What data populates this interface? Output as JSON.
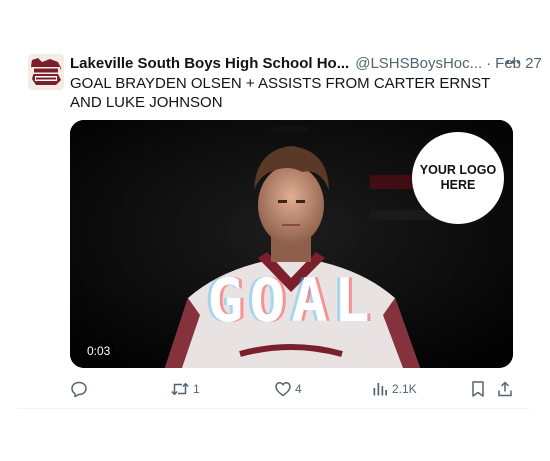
{
  "tweet": {
    "author_name": "Lakeville South Boys High School Ho...",
    "handle": "@LSHSBoysHoc...",
    "separator": "·",
    "date": "Feb 27",
    "text": "GOAL BRAYDEN OLSEN + ASSISTS FROM CARTER ERNST AND LUKE JOHNSON",
    "avatar_icon": "team-logo-icon",
    "menu_icon": "more-icon"
  },
  "media": {
    "logo_line1": "YOUR LOGO",
    "logo_line2": "HERE",
    "overlay_text": "GOAL",
    "timestamp": "0:03"
  },
  "actions": {
    "reply_icon": "reply-icon",
    "retweet_icon": "retweet-icon",
    "retweet_count": "1",
    "like_icon": "heart-icon",
    "like_count": "4",
    "views_icon": "views-icon",
    "views_count": "2.1K",
    "bookmark_icon": "bookmark-icon",
    "share_icon": "share-icon"
  },
  "colors": {
    "text_primary": "#0f1419",
    "text_secondary": "#536471",
    "jersey_maroon": "#7a1f2b"
  }
}
